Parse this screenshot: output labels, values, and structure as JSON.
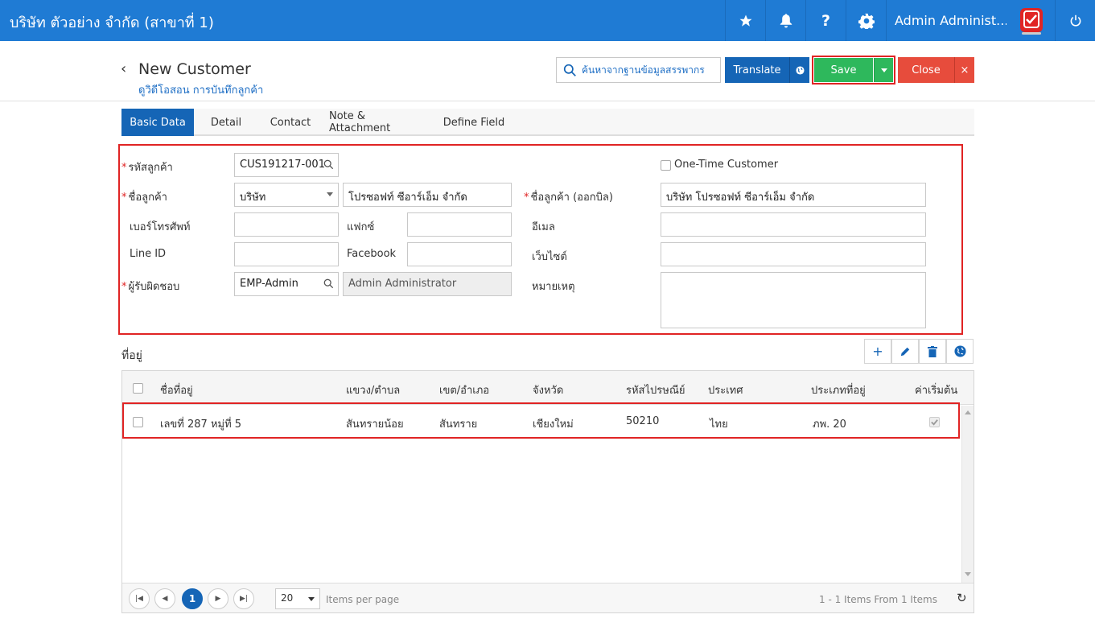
{
  "topbar": {
    "company": "บริษัท ตัวอย่าง จำกัด (สาขาที่ 1)",
    "user": "Admin Administ...",
    "icons": [
      "star-icon",
      "bell-icon",
      "help-icon",
      "gear-icon",
      "app-logo",
      "power-icon"
    ],
    "help_glyph": "?"
  },
  "header": {
    "back_glyph": "‹",
    "title": "New Customer",
    "subtitle": "ดูวิดีโอสอน การบันทึกลูกค้า",
    "search_label": "ค้นหาจากฐานข้อมูลสรรพากร",
    "translate_label": "Translate",
    "save_label": "Save",
    "close_label": "Close",
    "close_x": "×"
  },
  "tabs": [
    {
      "label": "Basic Data",
      "active": true
    },
    {
      "label": "Detail",
      "active": false
    },
    {
      "label": "Contact",
      "active": false
    },
    {
      "label": "Note & Attachment",
      "active": false
    },
    {
      "label": "Define Field",
      "active": false
    }
  ],
  "form": {
    "required_mark": "*",
    "customer_code_label": "รหัสลูกค้า",
    "customer_code_value": "CUS191217-001",
    "one_time_label": "One-Time Customer",
    "customer_name_label": "ชื่อลูกค้า",
    "customer_type_value": "บริษัท",
    "customer_name_value": "โปรซอฟท์ ซีอาร์เอ็ม จำกัด",
    "bill_name_label": "ชื่อลูกค้า (ออกบิล)",
    "bill_name_value": "บริษัท โปรซอฟท์ ซีอาร์เอ็ม จำกัด",
    "phone_label": "เบอร์โทรศัพท์",
    "phone_value": "",
    "fax_label": "แฟกซ์",
    "fax_value": "",
    "email_label": "อีเมล",
    "email_value": "",
    "line_label": "Line ID",
    "line_value": "",
    "facebook_label": "Facebook",
    "facebook_value": "",
    "website_label": "เว็บไซต์",
    "website_value": "",
    "owner_label": "ผู้รับผิดชอบ",
    "owner_code_value": "EMP-Admin",
    "owner_name_value": "Admin Administrator",
    "remark_label": "หมายเหตุ",
    "remark_value": ""
  },
  "address": {
    "title": "ที่อยู่",
    "tools": [
      "+",
      "pencil-icon",
      "trash-icon",
      "globe-icon"
    ],
    "columns": [
      "ชื่อที่อยู่",
      "แขวง/ตำบล",
      "เขต/อำเภอ",
      "จังหวัด",
      "รหัสไปรษณีย์",
      "ประเทศ",
      "ประเภทที่อยู่",
      "ค่าเริ่มต้น"
    ],
    "rows": [
      {
        "name": "เลขที่ 287 หมู่ที่ 5",
        "subdistrict": "สันทรายน้อย",
        "district": "สันทราย",
        "province": "เชียงใหม่",
        "postcode": "50210",
        "country": "ไทย",
        "type": "ภพ. 20",
        "default": true
      }
    ]
  },
  "pager": {
    "first": "|◀",
    "prev": "◀",
    "current_page": "1",
    "next": "▶",
    "last": "▶|",
    "page_size": "20",
    "items_per_page": "Items per page",
    "summary": "1 - 1 Items From 1 Items",
    "refresh": "↻"
  },
  "colors": {
    "topbar": "#1f7bd4",
    "primary": "#1565b6",
    "save": "#2eb85c",
    "close": "#e74c3c",
    "highlight": "#e02424"
  }
}
